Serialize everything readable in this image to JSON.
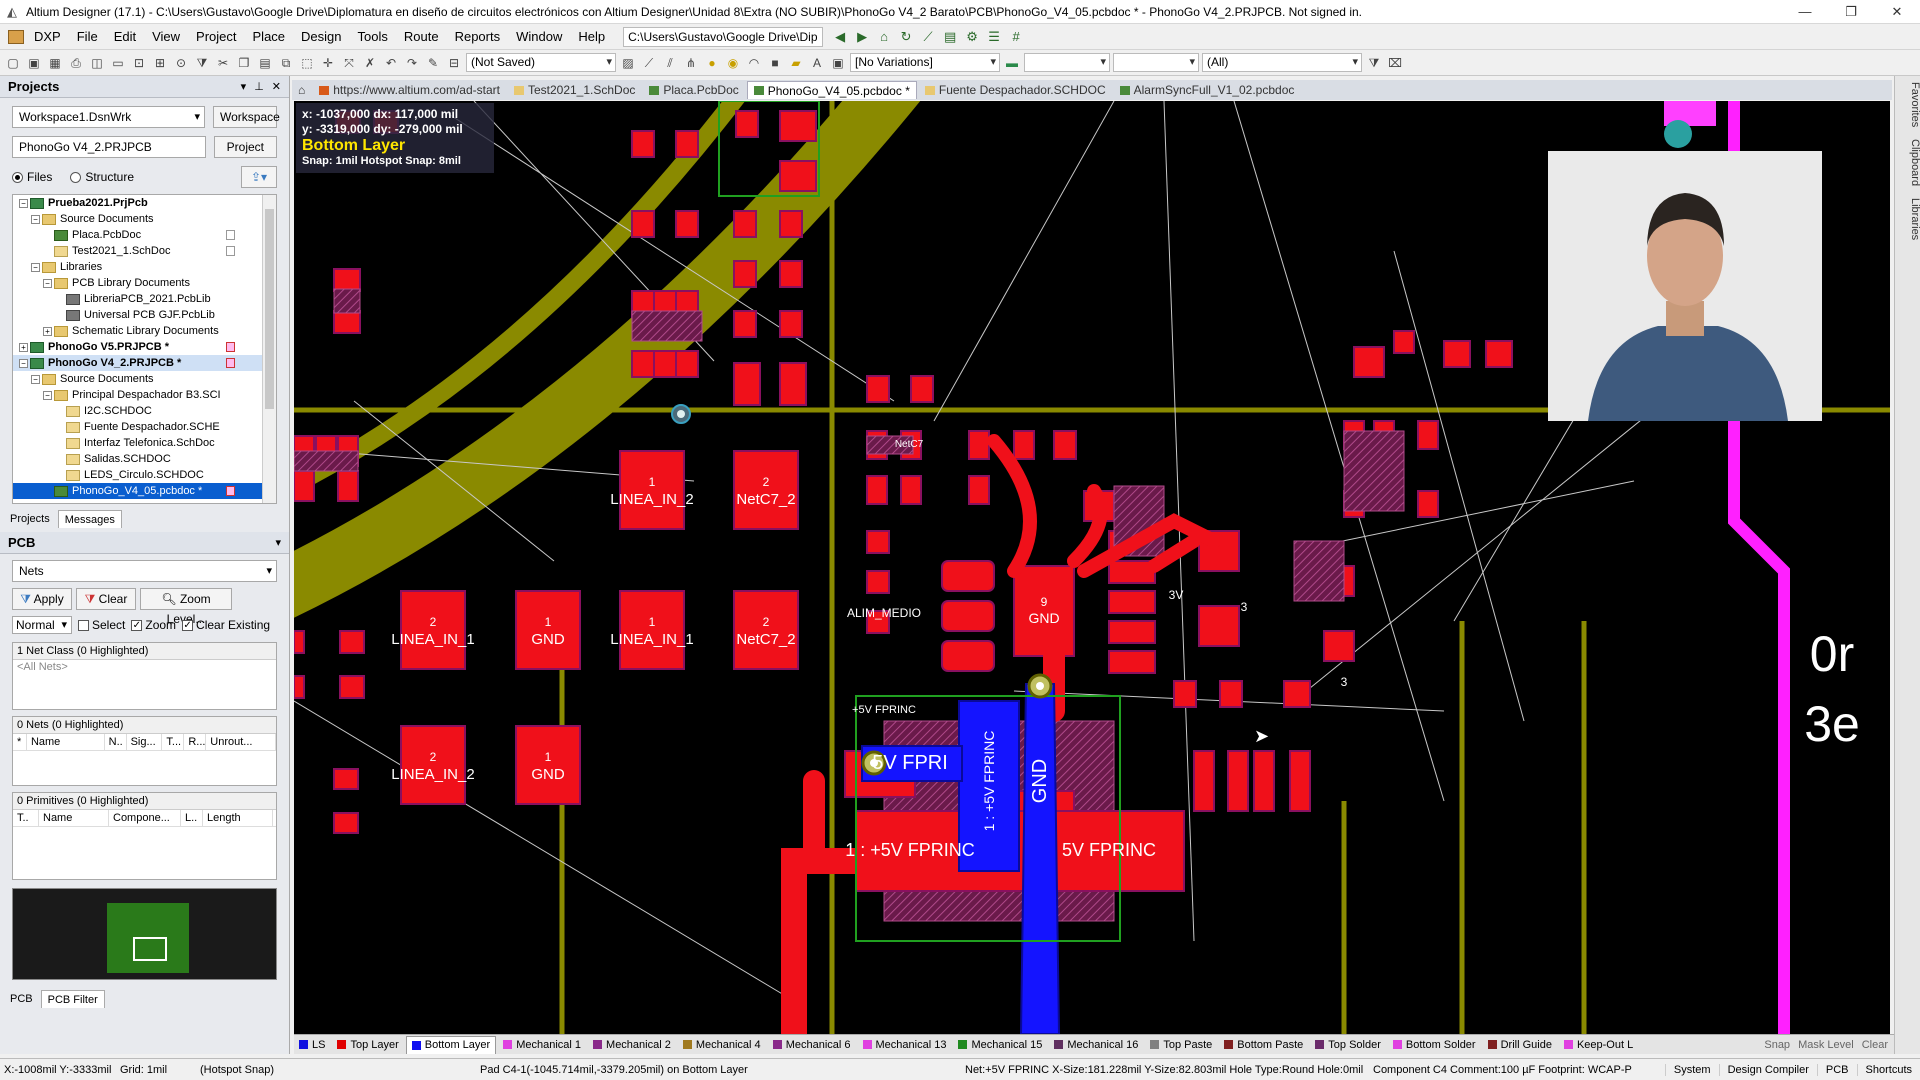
{
  "window": {
    "title": "Altium Designer (17.1) - C:\\Users\\Gustavo\\Google Drive\\Diplomatura en diseño de circuitos electrónicos con Altium Designer\\Unidad 8\\Extra (NO SUBIR)\\PhonoGo V4_2 Barato\\PCB\\PhonoGo_V4_05.pcbdoc * - PhonoGo V4_2.PRJPCB. Not signed in.",
    "minimize": "—",
    "maximize": "❐",
    "close": "✕"
  },
  "menu": {
    "items": [
      "DXP",
      "File",
      "Edit",
      "View",
      "Project",
      "Place",
      "Design",
      "Tools",
      "Route",
      "Reports",
      "Window",
      "Help"
    ],
    "path_combo": "C:\\Users\\Gustavo\\Google Drive\\Dip"
  },
  "toolbar": {
    "not_saved": "(Not Saved)",
    "variations": "[No Variations]",
    "all": "(All)"
  },
  "projects_panel": {
    "title": "Projects",
    "workspace_combo": "Workspace1.DsnWrk",
    "workspace_btn": "Workspace",
    "project_field": "PhonoGo V4_2.PRJPCB",
    "project_btn": "Project",
    "radio_files": "Files",
    "radio_structure": "Structure",
    "tree": [
      {
        "label": "Prueba2021.PrjPcb",
        "indent": 0,
        "icon": "proj",
        "exp": "−",
        "bold": true
      },
      {
        "label": "Source Documents",
        "indent": 1,
        "icon": "folder",
        "exp": "−"
      },
      {
        "label": "Placa.PcbDoc",
        "indent": 2,
        "icon": "pcb",
        "flag": "doc"
      },
      {
        "label": "Test2021_1.SchDoc",
        "indent": 2,
        "icon": "sch",
        "flag": "doc"
      },
      {
        "label": "Libraries",
        "indent": 1,
        "icon": "folder",
        "exp": "−"
      },
      {
        "label": "PCB Library Documents",
        "indent": 2,
        "icon": "folder",
        "exp": "−"
      },
      {
        "label": "LibreriaPCB_2021.PcbLib",
        "indent": 3,
        "icon": "lib"
      },
      {
        "label": "Universal PCB GJF.PcbLib",
        "indent": 3,
        "icon": "lib"
      },
      {
        "label": "Schematic Library Documents",
        "indent": 2,
        "icon": "folder",
        "exp": "+"
      },
      {
        "label": "PhonoGo V5.PRJPCB *",
        "indent": 0,
        "icon": "proj",
        "exp": "+",
        "bold": true,
        "flag": "mod"
      },
      {
        "label": "PhonoGo V4_2.PRJPCB *",
        "indent": 0,
        "icon": "proj",
        "exp": "−",
        "bold": true,
        "flag": "mod",
        "hl": true
      },
      {
        "label": "Source Documents",
        "indent": 1,
        "icon": "folder",
        "exp": "−"
      },
      {
        "label": "Principal Despachador B3.SCI",
        "indent": 2,
        "icon": "folder",
        "exp": "−"
      },
      {
        "label": "I2C.SCHDOC",
        "indent": 3,
        "icon": "sch"
      },
      {
        "label": "Fuente Despachador.SCHE",
        "indent": 3,
        "icon": "sch"
      },
      {
        "label": "Interfaz Telefonica.SchDoc",
        "indent": 3,
        "icon": "sch"
      },
      {
        "label": "Salidas.SCHDOC",
        "indent": 3,
        "icon": "sch"
      },
      {
        "label": "LEDS_Circulo.SCHDOC",
        "indent": 3,
        "icon": "sch"
      },
      {
        "label": "PhonoGo_V4_05.pcbdoc *",
        "indent": 2,
        "icon": "pcb",
        "sel": true,
        "flag": "mod"
      }
    ],
    "tabs": [
      "Projects",
      "Messages"
    ]
  },
  "pcb_panel": {
    "title": "PCB",
    "mode_combo": "Nets",
    "apply_btn": "Apply",
    "clear_btn": "Clear",
    "zoom_btn": "Zoom Level...",
    "mask_combo": "Normal",
    "select_label": "Select",
    "zoom_label": "Zoom",
    "clear_existing_label": "Clear Existing",
    "netclass_header": "1 Net Class (0 Highlighted)",
    "netclass_item": "<All Nets>",
    "nets_header": "0 Nets (0 Highlighted)",
    "nets_cols": [
      "*",
      "Name",
      "N..",
      "Sig...",
      "T...",
      "R...",
      "Unrout..."
    ],
    "prims_header": "0 Primitives (0 Highlighted)",
    "prims_cols": [
      "T..",
      "Name",
      "Compone...",
      "L..",
      "Length"
    ],
    "bottom_tabs": [
      "PCB",
      "PCB Filter"
    ]
  },
  "doc_tabs": [
    {
      "label": "https://www.altium.com/ad-start",
      "color": "#d85a1a"
    },
    {
      "label": "Test2021_1.SchDoc",
      "color": "#e8c870"
    },
    {
      "label": "Placa.PcbDoc",
      "color": "#4a8a3a"
    },
    {
      "label": "PhonoGo_V4_05.pcbdoc *",
      "color": "#4a8a3a",
      "active": true
    },
    {
      "label": "Fuente Despachador.SCHDOC",
      "color": "#e8c870"
    },
    {
      "label": "AlarmSyncFull_V1_02.pcbdoc",
      "color": "#4a8a3a"
    }
  ],
  "right_strip": [
    "Favorites",
    "Clipboard",
    "Libraries"
  ],
  "hud": {
    "line1": "x: -1037,000   dx:  117,000 mil",
    "line2": "y: -3319,000   dy: -279,000 mil",
    "layer": "Bottom Layer",
    "snap": "Snap: 1mil Hotspot Snap: 8mil"
  },
  "pcb_labels": {
    "linea_in_2a": "LINEA_IN_2",
    "netc7_2a": "NetC7_2",
    "linea_in_1a": "LINEA_IN_1",
    "gnd_a": "GND",
    "linea_in_1b": "LINEA_IN_1",
    "netc7_2b": "NetC7_2",
    "linea_in_2b": "LINEA_IN_2",
    "gnd_b": "GND",
    "alim_medio": "ALIM_MEDIO",
    "gnd_c": "GND",
    "v5_fprinc_a": "5V FPRI",
    "v5_fprinc_b": "1 : +5V FPRINC",
    "v5_fprinc_c": "5V FPRINC",
    "v5_fprinc_v": "1 : +5V FPRINC",
    "gnd_trace": "GND",
    "pin1": "1",
    "pin2": "2",
    "pin9": "9",
    "pin3": "3",
    "netc7": "NetC7",
    "v5_small": "+5V FPRINC",
    "v3": "3V",
    "big_0": "0r",
    "big_3": "3e"
  },
  "layer_tabs": [
    {
      "label": "LS",
      "color": "#1010e0"
    },
    {
      "label": "Top Layer",
      "color": "#e00000"
    },
    {
      "label": "Bottom Layer",
      "color": "#1010f0",
      "active": true
    },
    {
      "label": "Mechanical 1",
      "color": "#e040e0"
    },
    {
      "label": "Mechanical 2",
      "color": "#8a2a8a"
    },
    {
      "label": "Mechanical 4",
      "color": "#a07a20"
    },
    {
      "label": "Mechanical 6",
      "color": "#8a2a8a"
    },
    {
      "label": "Mechanical 13",
      "color": "#e040e0"
    },
    {
      "label": "Mechanical 15",
      "color": "#208a20"
    },
    {
      "label": "Mechanical 16",
      "color": "#603060"
    },
    {
      "label": "Top Paste",
      "color": "#808080"
    },
    {
      "label": "Bottom Paste",
      "color": "#802020"
    },
    {
      "label": "Top Solder",
      "color": "#6a2a6a"
    },
    {
      "label": "Bottom Solder",
      "color": "#e040e0"
    },
    {
      "label": "Drill Guide",
      "color": "#802020"
    },
    {
      "label": "Keep-Out L",
      "color": "#e040e0"
    }
  ],
  "layer_tools": [
    "Snap",
    "Mask Level",
    "Clear"
  ],
  "status": {
    "coords": "X:-1008mil Y:-3333mil",
    "grid": "Grid: 1mil",
    "hotspot": "(Hotspot Snap)",
    "pad_info": "Pad C4-1(-1045.714mil,-3379.205mil) on Bottom Layer",
    "net_info": "Net:+5V FPRINC X-Size:181.228mil Y-Size:82.803mil Hole Type:Round Hole:0mil",
    "comp_info": "Component C4 Comment:100 µF Footprint: WCAP-P",
    "buttons": [
      "System",
      "Design Compiler",
      "PCB",
      "Shortcuts"
    ]
  }
}
